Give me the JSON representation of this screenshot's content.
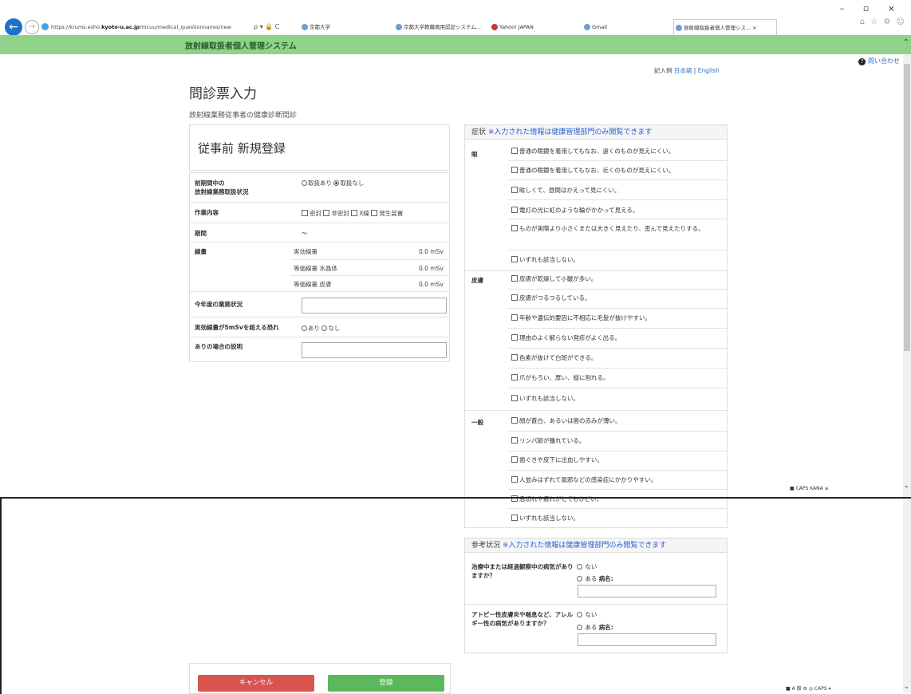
{
  "browser": {
    "url_prefix": "https://krums.esho.",
    "url_domain": "kyoto-u.ac.jp",
    "url_path": "/mcuu/medical_questionnaires/new",
    "addr_icons": "ρ ▾ 🔒 C",
    "tabs": [
      {
        "label": "京都大学",
        "active": false
      },
      {
        "label": "京都大学教職員用認証システム...",
        "active": false
      },
      {
        "label": "Yahoo! JAPAN",
        "active": false
      },
      {
        "label": "Gmail",
        "active": false
      },
      {
        "label": "放射線取扱者個人管理シス...  ×",
        "active": true
      }
    ],
    "window_controls": "– ▫ ×",
    "toolbar_icons": "⌂ ☆ ⚙ ☺"
  },
  "app": {
    "title": "放射線取扱者個人管理システム",
    "help_label": "問い合わせ",
    "lang_prefix": "記入例 ",
    "lang_ja": "日本語",
    "lang_sep": " | ",
    "lang_en": "English"
  },
  "page": {
    "title": "問診票入力",
    "subtitle": "放射線業務従事者の健康診断問診",
    "register_title": "従事前 新規登録"
  },
  "form": {
    "handling_label_1": "前期間中の",
    "handling_label_2": "放射線業務取扱状況",
    "handling_yes": "取扱あり",
    "handling_no": "取扱なし",
    "work_label": "作業内容",
    "work_opts": [
      "密封",
      "非密封",
      "X線",
      "発生装置"
    ],
    "period_label": "期間",
    "period_value": "〜",
    "dose_label": "線量",
    "dose_rows": [
      {
        "name": "実効線量",
        "value": "0.0 mSv"
      },
      {
        "name": "等価線量 水晶体",
        "value": "0.0 mSv"
      },
      {
        "name": "等価線量 皮膚",
        "value": "0.0 mSv"
      }
    ],
    "status_label": "今年度の業務状況",
    "risk_label": "実効線量が5mSvを超える恐れ",
    "risk_yes": "あり",
    "risk_no": "なし",
    "explain_label": "ありの場合の説明"
  },
  "symptoms": {
    "header": "症状",
    "note": "※入力された情報は健康管理部門のみ閲覧できます",
    "eye_label": "眼",
    "eye_items": [
      "普通の眼鏡を着用してもなお、遠くのものが見えにくい。",
      "普通の眼鏡を着用してもなお、近くのものが見えにくい。",
      "眩しくて、昼間はかえって見にくい。",
      "電灯の光に虹のような輪がかかって見える。",
      "ものが実際より小さくまたは大きく見えたり、歪んで見えたりする。",
      "いずれも該当しない。"
    ],
    "skin_label": "皮膚",
    "skin_items": [
      "皮膚が乾燥して小皺が多い。",
      "皮膚がつるつるしている。",
      "年齢や遺伝的要因に不相応に毛髪が抜けやすい。",
      "理由のよく解らない発疹がよく出る。",
      "色素が抜けて白斑ができる。",
      "爪がもろい、厚い、縦に割れる。",
      "いずれも該当しない。"
    ],
    "general_label": "一般",
    "general_items": [
      "顔が蒼白、あるいは唇の赤みが薄い。",
      "リンパ節が腫れている。",
      "歯ぐきや皮下に出血しやすい。",
      "人並みはずれて風邪などの感染症にかかりやすい。",
      "息切れや疲れがとてもひどい。",
      "いずれも該当しない。"
    ]
  },
  "reference": {
    "header": "参考状況",
    "note": "※入力された情報は健康管理部門のみ閲覧できます",
    "q1": "治療中または経過観察中の病気がありますか？",
    "q2": "アトピー性皮膚炎や喘息など、アレルギー性の病気がありますか？",
    "opt_no": "ない",
    "opt_yes": "ある",
    "disease_label": "病名:"
  },
  "buttons": {
    "cancel": "キャンセル",
    "save": "登録"
  },
  "ime": {
    "top": "■ CAPS KANA ≡",
    "bottom": "■ A 般 ⚙ ◎ CAPS ▾"
  },
  "colors": {
    "header_green": "#8fd38b",
    "cancel_red": "#d9534f",
    "save_green": "#5cb85c",
    "note_blue": "#2b5fd8"
  }
}
